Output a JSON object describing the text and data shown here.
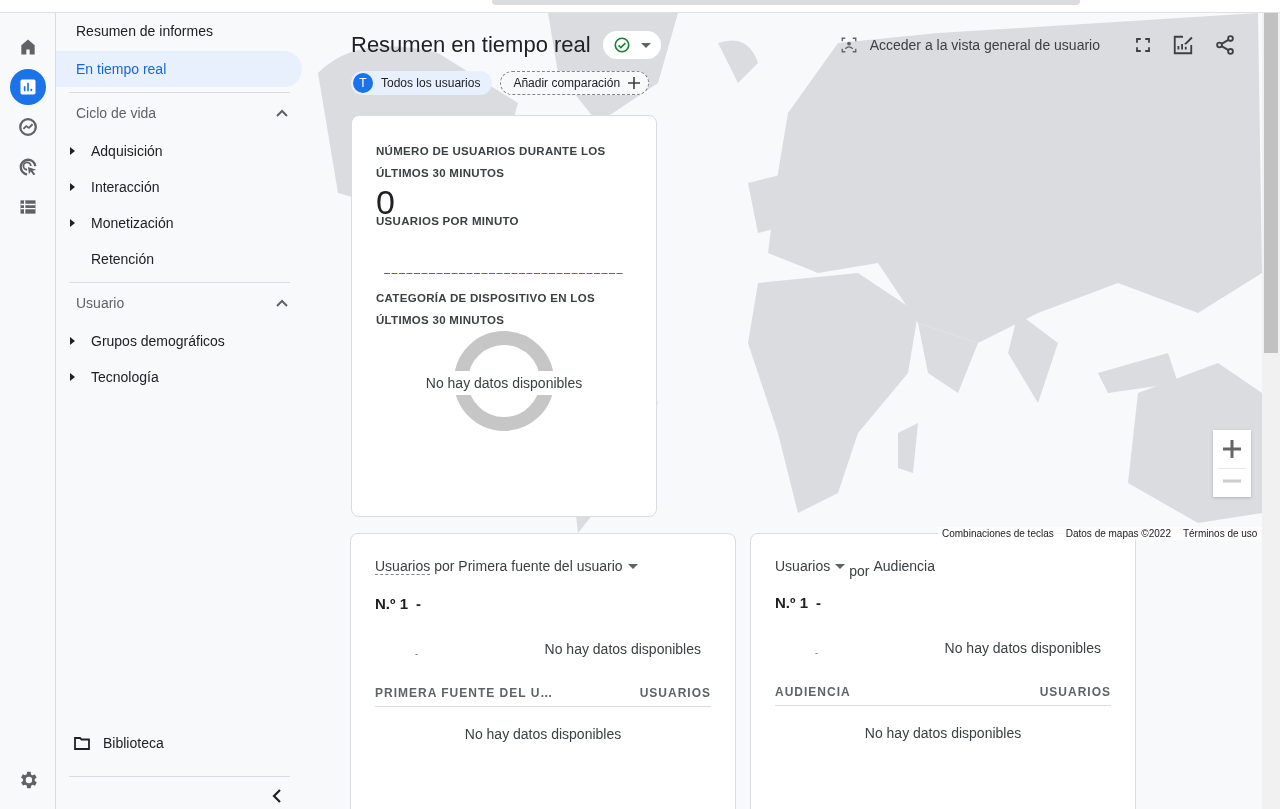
{
  "rail": {
    "items": [
      {
        "kind": "home",
        "selected": false
      },
      {
        "kind": "reports",
        "selected": true
      },
      {
        "kind": "explore",
        "selected": false
      },
      {
        "kind": "advertising",
        "selected": false
      },
      {
        "kind": "configure",
        "selected": false
      }
    ]
  },
  "sidebar": {
    "top_items": [
      {
        "label": "Resumen de informes",
        "selected": false
      },
      {
        "label": "En tiempo real",
        "selected": true
      }
    ],
    "sections": [
      {
        "title": "Ciclo de vida",
        "expanded": true,
        "items": [
          {
            "label": "Adquisición",
            "expandable": true
          },
          {
            "label": "Interacción",
            "expandable": true
          },
          {
            "label": "Monetización",
            "expandable": true
          },
          {
            "label": "Retención",
            "expandable": false
          }
        ]
      },
      {
        "title": "Usuario",
        "expanded": true,
        "items": [
          {
            "label": "Grupos demográficos",
            "expandable": true
          },
          {
            "label": "Tecnología",
            "expandable": true
          }
        ]
      }
    ],
    "library": "Biblioteca"
  },
  "header": {
    "title": "Resumen en tiempo real",
    "user_overview": "Acceder a la vista general de usuario"
  },
  "chips": {
    "segment_initial": "T",
    "segment": "Todos los usuarios",
    "add_comparison": "Añadir comparación"
  },
  "users_card": {
    "heading": "NÚMERO DE USUARIOS DURANTE LOS ÚLTIMOS 30 MINUTOS",
    "value": "0",
    "per_minute": "USUARIOS POR MINUTO",
    "device_heading": "CATEGORÍA DE DISPOSITIVO EN LOS ÚLTIMOS 30 MINUTOS",
    "empty": "No hay datos disponibles"
  },
  "map": {
    "attribution": [
      "Combinaciones de teclas",
      "Datos de mapas ©2022",
      "Términos de uso"
    ]
  },
  "cards": [
    {
      "kind": "dimension-menu",
      "metric": "Usuarios",
      "connector": "por",
      "dimension": "Primera fuente del usuario",
      "rank": "N.º 1",
      "rank_value": "-",
      "axis_dash": "-",
      "empty": "No hay datos disponibles",
      "column_1": "PRIMERA FUENTE DEL U…",
      "column_2": "USUARIOS",
      "table_empty": "No hay datos disponibles"
    },
    {
      "kind": "metric-menu",
      "metric": "Usuarios",
      "connector": "por",
      "dimension": "Audiencia",
      "rank": "N.º 1",
      "rank_value": "-",
      "axis_dash": "-",
      "empty": "No hay datos disponibles",
      "column_1": "AUDIENCIA",
      "column_2": "USUARIOS",
      "table_empty": "No hay datos disponibles"
    }
  ]
}
